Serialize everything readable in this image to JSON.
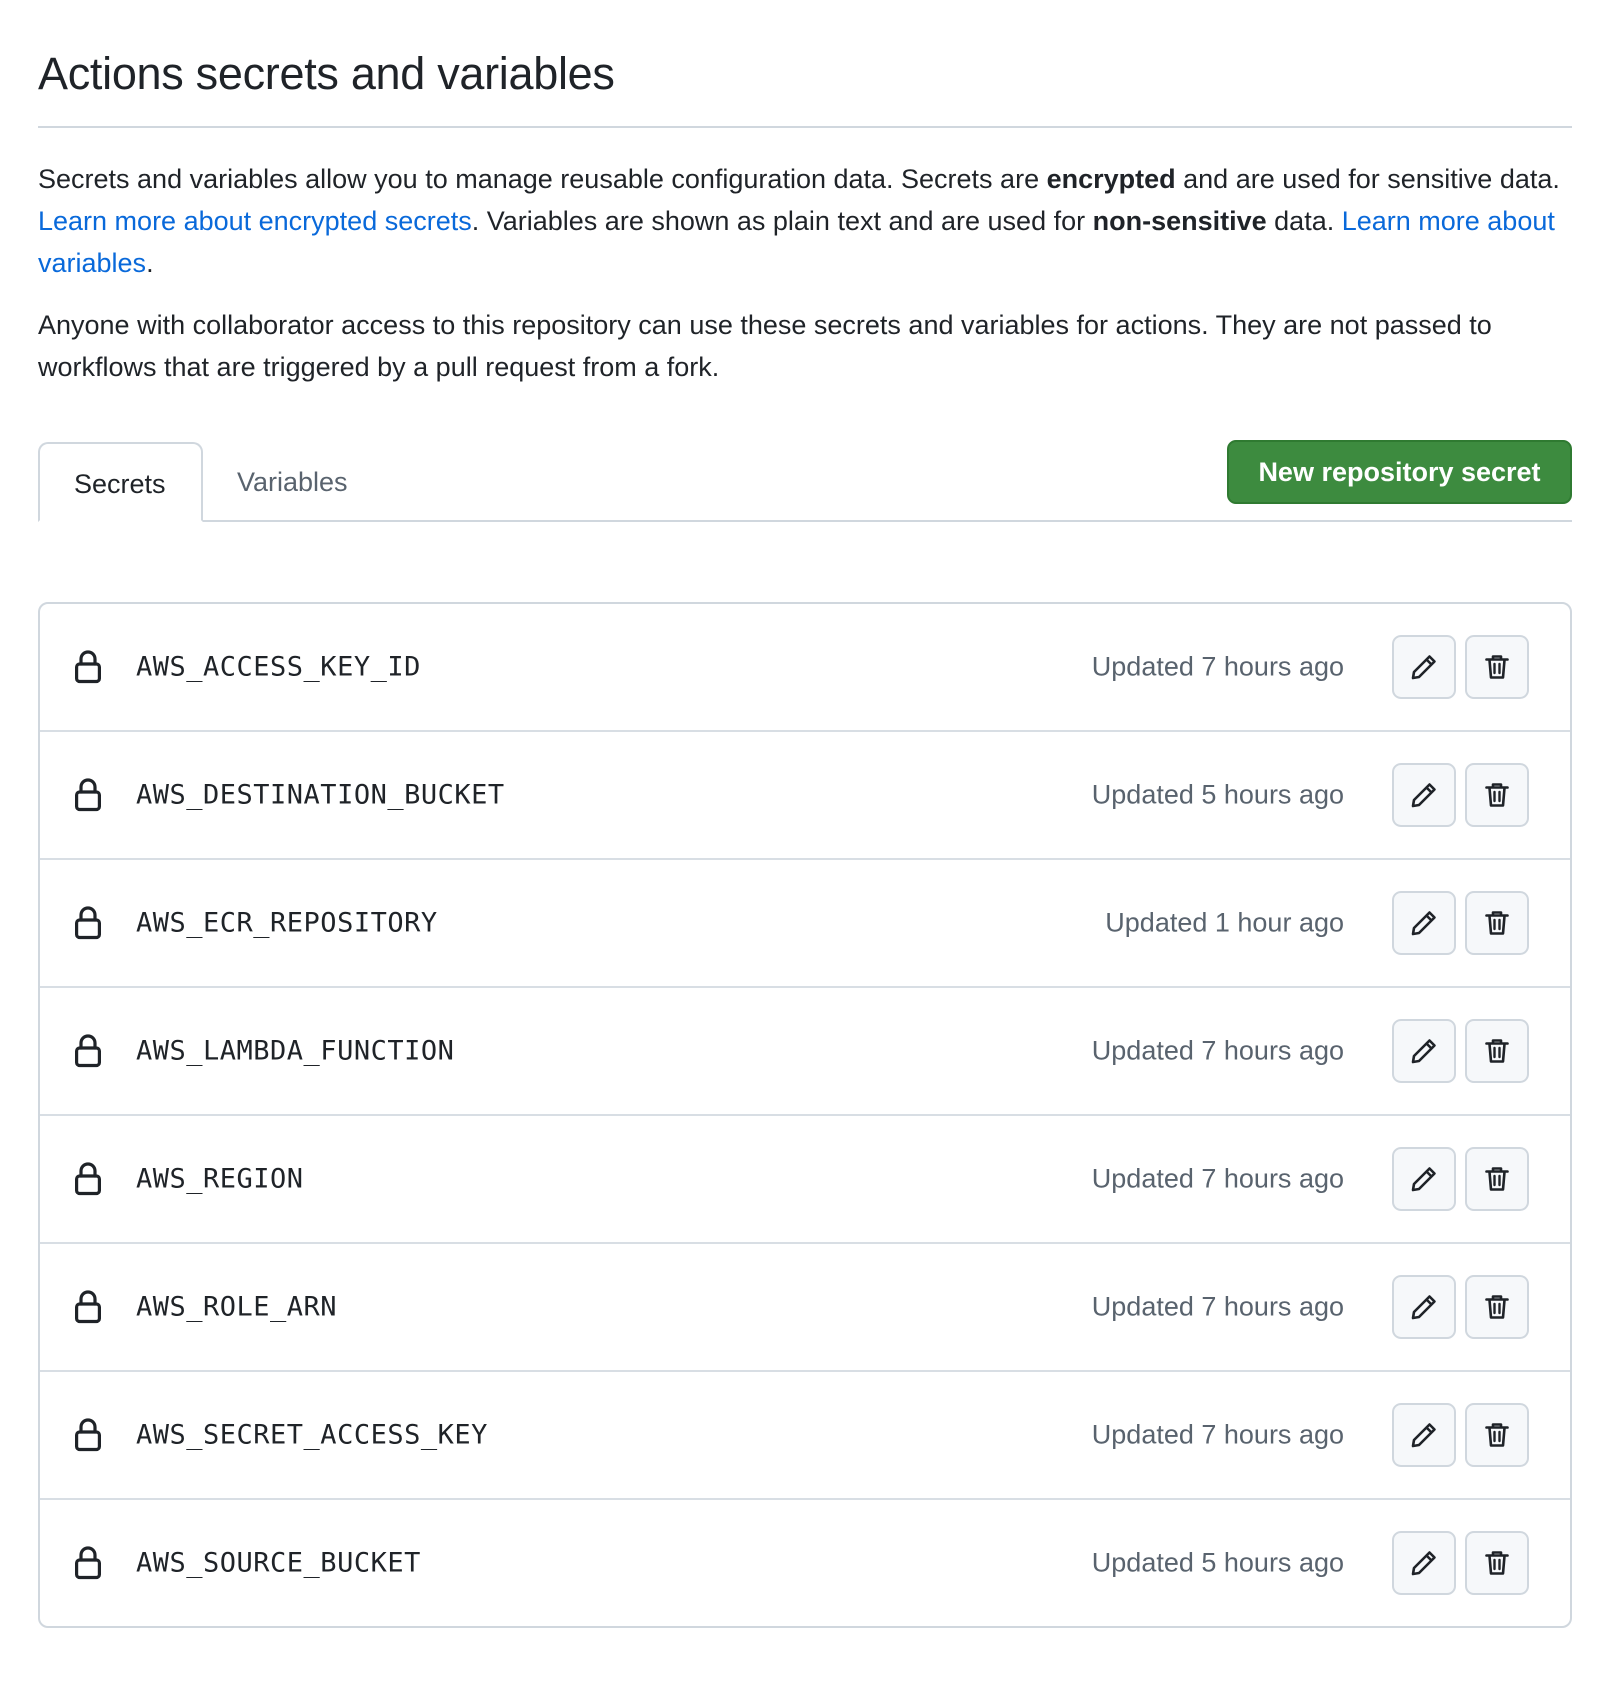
{
  "page": {
    "title": "Actions secrets and variables",
    "desc1_part1": "Secrets and variables allow you to manage reusable configuration data. Secrets are ",
    "desc1_bold1": "encrypted",
    "desc1_part2": " and are used for sensitive data. ",
    "desc1_link1": "Learn more about encrypted secrets",
    "desc1_part3": ". Variables are shown as plain text and are used for ",
    "desc1_bold2": "non-sensitive",
    "desc1_part4": " data. ",
    "desc1_link2": "Learn more about variables",
    "desc1_part5": ".",
    "desc2": "Anyone with collaborator access to this repository can use these secrets and variables for actions. They are not passed to workflows that are triggered by a pull request from a fork."
  },
  "tabs": {
    "secrets_label": "Secrets",
    "variables_label": "Variables",
    "active": "Secrets"
  },
  "actions": {
    "new_secret_label": "New repository secret"
  },
  "icons": {
    "lock": "lock-icon",
    "edit": "pencil-icon",
    "delete": "trash-icon"
  },
  "colors": {
    "primary_button": "#3d8b3f",
    "link": "#0969da",
    "muted_text": "#59636e"
  },
  "secrets": [
    {
      "name": "AWS_ACCESS_KEY_ID",
      "updated": "Updated 7 hours ago"
    },
    {
      "name": "AWS_DESTINATION_BUCKET",
      "updated": "Updated 5 hours ago"
    },
    {
      "name": "AWS_ECR_REPOSITORY",
      "updated": "Updated 1 hour ago"
    },
    {
      "name": "AWS_LAMBDA_FUNCTION",
      "updated": "Updated 7 hours ago"
    },
    {
      "name": "AWS_REGION",
      "updated": "Updated 7 hours ago"
    },
    {
      "name": "AWS_ROLE_ARN",
      "updated": "Updated 7 hours ago"
    },
    {
      "name": "AWS_SECRET_ACCESS_KEY",
      "updated": "Updated 7 hours ago"
    },
    {
      "name": "AWS_SOURCE_BUCKET",
      "updated": "Updated 5 hours ago"
    }
  ]
}
